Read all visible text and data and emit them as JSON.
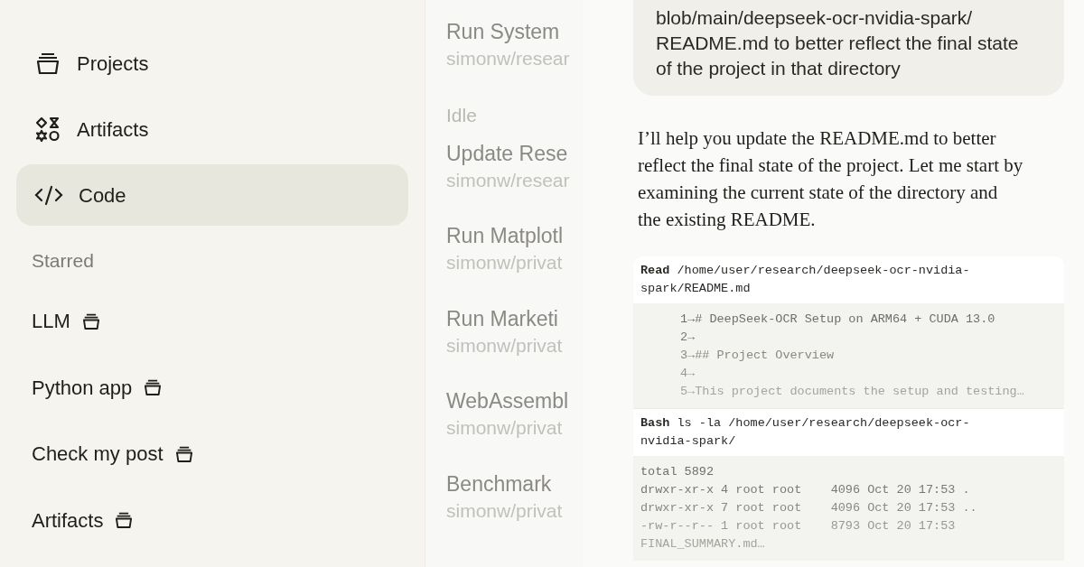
{
  "sidebar": {
    "nav": [
      {
        "label": "Projects",
        "kind": "projects",
        "selected": false
      },
      {
        "label": "Artifacts",
        "kind": "artifacts",
        "selected": false
      },
      {
        "label": "Code",
        "kind": "code",
        "selected": true
      }
    ],
    "starred_heading": "Starred",
    "starred": [
      {
        "label": "LLM"
      },
      {
        "label": "Python app"
      },
      {
        "label": "Check my post"
      },
      {
        "label": "Artifacts"
      }
    ]
  },
  "sessions": [
    {
      "kind": "session",
      "title": "Run System",
      "repo": "simonw/resear"
    },
    {
      "kind": "heading",
      "text": "Idle"
    },
    {
      "kind": "session",
      "title": "Update Rese",
      "repo": "simonw/resear"
    },
    {
      "kind": "session",
      "title": "Run Matplotl",
      "repo": "simonw/privat"
    },
    {
      "kind": "session",
      "title": "Run Marketi",
      "repo": "simonw/privat"
    },
    {
      "kind": "session",
      "title": "WebAssembl",
      "repo": "simonw/privat"
    },
    {
      "kind": "session",
      "title": "Benchmark",
      "repo": "simonw/privat"
    }
  ],
  "chat": {
    "user_message": [
      "blob/main/deepseek-ocr-nvidia-spark/",
      "README.md to better reflect the final state",
      "of the project in that directory"
    ],
    "reply": "I’ll help you update the README.md to better reflect the final state of the project. Let me start by examining the current state of the directory and the existing README.",
    "tool_calls": [
      {
        "tool": "Read",
        "command": "/home/user/research/deepseek-ocr-nvidia-spark/README.md",
        "numbered": true,
        "output": [
          "1→# DeepSeek-OCR Setup on ARM64 + CUDA 13.0",
          "2→",
          "3→## Project Overview",
          "4→",
          "5→This project documents the setup and testing…"
        ]
      },
      {
        "tool": "Bash",
        "command": "ls -la /home/user/research/deepseek-ocr-nvidia-spark/",
        "numbered": false,
        "output": [
          "total 5892",
          "drwxr-xr-x 4 root root    4096 Oct 20 17:53 .",
          "drwxr-xr-x 7 root root    4096 Oct 20 17:53 ..",
          "-rw-r--r-- 1 root root    8793 Oct 20 17:53",
          "FINAL_SUMMARY.md…"
        ]
      }
    ]
  }
}
